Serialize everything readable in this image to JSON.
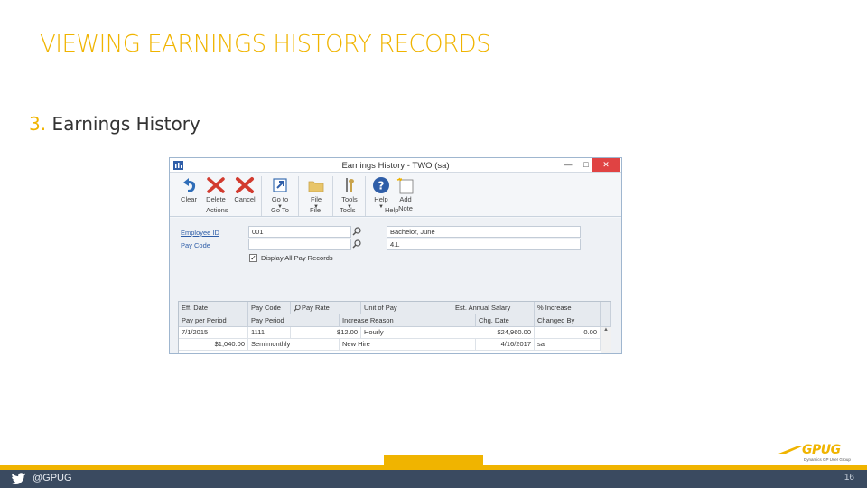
{
  "slide": {
    "title": "VIEWING EARNINGS HISTORY RECORDS",
    "step_number": "3.",
    "step_text": " Earnings History",
    "page_number": "16",
    "twitter_handle": "@GPUG",
    "logo_text": "GPUG",
    "logo_sub": "Dynamics GP User Group"
  },
  "window": {
    "title": "Earnings History  -  TWO (sa)",
    "controls": {
      "minimize": "—",
      "maximize": "□",
      "close": "✕"
    }
  },
  "ribbon": {
    "buttons": [
      {
        "label": "Clear",
        "icon": "undo-icon"
      },
      {
        "label": "Delete",
        "icon": "delete-x-icon"
      },
      {
        "label": "Cancel",
        "icon": "cancel-x-icon"
      },
      {
        "label": "Go to",
        "icon": "goto-arrow-icon"
      },
      {
        "label": "File",
        "icon": "folder-icon"
      },
      {
        "label": "Tools",
        "icon": "tools-icon"
      },
      {
        "label": "Help",
        "icon": "help-icon"
      },
      {
        "label": "Add Note",
        "label_line1": "Add",
        "label_line2": "Note",
        "icon": "note-icon"
      }
    ],
    "groups": [
      "Actions",
      "Go To",
      "File",
      "Tools",
      "Help"
    ],
    "dropdown_arrow": "▼"
  },
  "form": {
    "employee_id_label": "Employee ID",
    "employee_id_value": "001",
    "pay_code_label": "Pay Code",
    "pay_code_value": "",
    "employee_name": "Bachelor, June",
    "employee_code": "4.L",
    "display_all_label": "Display All Pay Records",
    "display_all_checked": true,
    "check_mark": "✓"
  },
  "grid": {
    "headers_row1": [
      "Eff. Date",
      "Pay Code",
      "Pay Rate",
      "Unit of Pay",
      "Est. Annual Salary",
      "% Increase"
    ],
    "headers_row2": [
      "Pay per Period",
      "Pay Period",
      "Increase Reason",
      "Chg. Date",
      "Changed By"
    ],
    "row1": [
      "7/1/2015",
      "1111",
      "$12.00",
      "Hourly",
      "$24,960.00",
      "0.00"
    ],
    "row2": [
      "$1,040.00",
      "Semimonthly",
      "New Hire",
      "4/16/2017",
      "sa"
    ],
    "scroll_up": "▲"
  }
}
